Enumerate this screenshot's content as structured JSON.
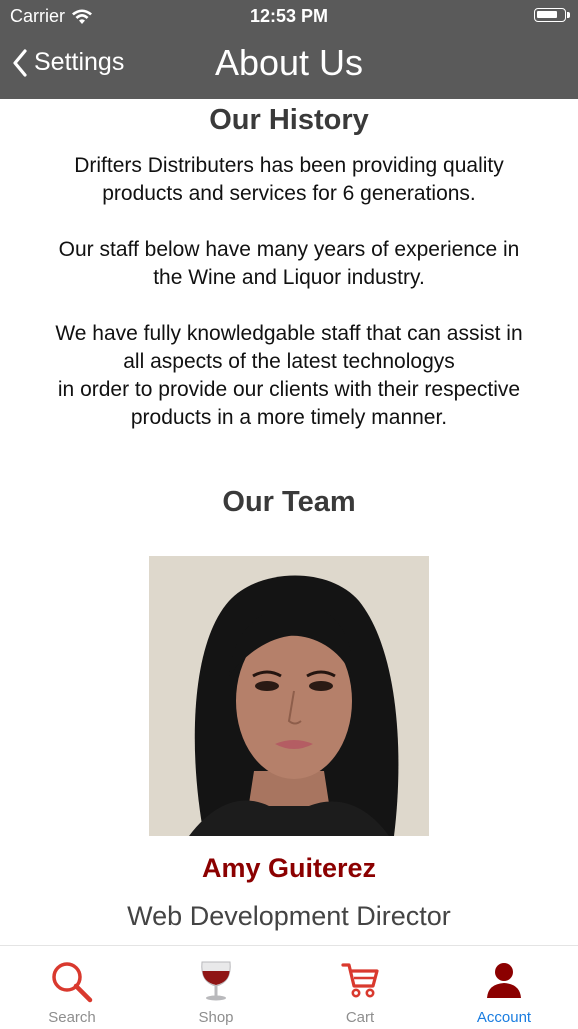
{
  "status": {
    "carrier": "Carrier",
    "time": "12:53 PM"
  },
  "nav": {
    "back_label": "Settings",
    "title": "About Us"
  },
  "history": {
    "heading": "Our History",
    "p1": [
      "Drifters Distributers has been providing quality",
      "products and services for 6 generations."
    ],
    "p2": [
      "Our staff below have many years of experience in",
      "the Wine and Liquor industry."
    ],
    "p3": [
      "We have fully knowledgable staff that can assist in",
      "all aspects of the latest technologys",
      "in order to provide our clients with their respective",
      "products in a more timely manner."
    ]
  },
  "team": {
    "heading": "Our Team",
    "member": {
      "name": "Amy Guiterez",
      "role": "Web Development Director"
    }
  },
  "tabs": [
    {
      "label": "Search",
      "icon": "search-icon",
      "active": false
    },
    {
      "label": "Shop",
      "icon": "wine-glass-icon",
      "active": false
    },
    {
      "label": "Cart",
      "icon": "cart-icon",
      "active": false
    },
    {
      "label": "Account",
      "icon": "account-icon",
      "active": true
    }
  ],
  "colors": {
    "bar": "#5a5a5a",
    "accent": "#8b0000",
    "active_tab": "#1a7de0"
  }
}
